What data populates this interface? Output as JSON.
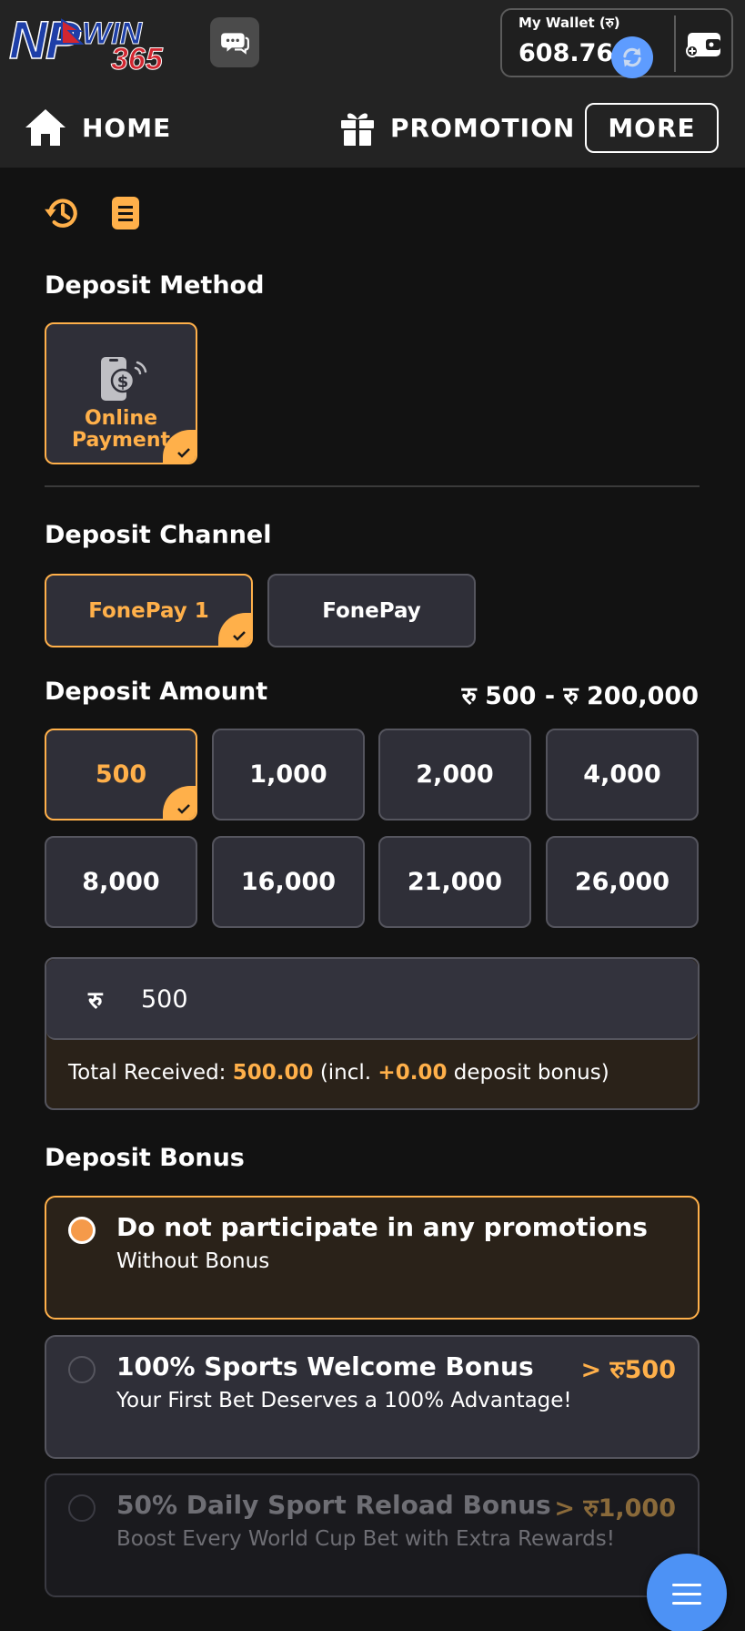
{
  "header": {
    "logo_text": "NPWIN365",
    "wallet_label": "My Wallet (रु)",
    "wallet_balance": "608.76"
  },
  "nav": {
    "home_label": "HOME",
    "promotion_label": "PROMOTION",
    "more_label": "MORE"
  },
  "deposit_method": {
    "title": "Deposit Method",
    "methods": [
      {
        "label": "Online Payment",
        "selected": true,
        "icon": "mobile-payment-icon"
      }
    ]
  },
  "deposit_channel": {
    "title": "Deposit Channel",
    "channels": [
      {
        "label": "FonePay 1",
        "selected": true
      },
      {
        "label": "FonePay",
        "selected": false
      }
    ]
  },
  "deposit_amount": {
    "title": "Deposit Amount",
    "range": "रु 500 - रु 200,000",
    "options": [
      "500",
      "1,000",
      "2,000",
      "4,000",
      "8,000",
      "16,000",
      "21,000",
      "26,000"
    ],
    "selected_option": "500",
    "currency_symbol": "रु",
    "input_value": "500",
    "total_prefix": "Total Received:",
    "total_value": "500.00",
    "total_mid": "(incl.",
    "bonus_value": "+0.00",
    "total_suffix": "deposit bonus)"
  },
  "deposit_bonus": {
    "title": "Deposit Bonus",
    "options": [
      {
        "title": "Do not participate in any promotions",
        "subtitle": "Without Bonus",
        "min": "",
        "selected": true,
        "disabled": false
      },
      {
        "title": "100% Sports Welcome Bonus",
        "subtitle": "Your First Bet Deserves a 100% Advantage!",
        "min": "> रु500",
        "selected": false,
        "disabled": false
      },
      {
        "title": "50% Daily Sport Reload Bonus",
        "subtitle": "Boost Every World Cup Bet with Extra Rewards!",
        "min": "> रु1,000",
        "selected": false,
        "disabled": true
      }
    ]
  },
  "colors": {
    "accent": "#ffb04a",
    "background": "#121212",
    "card": "#2f2f38",
    "header": "#232323",
    "fab": "#4d92f5"
  }
}
